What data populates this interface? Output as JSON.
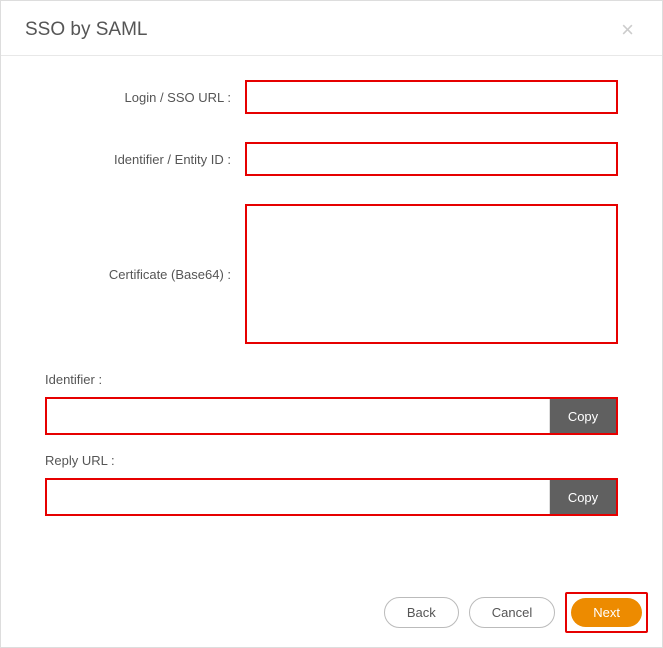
{
  "dialog": {
    "title": "SSO by SAML",
    "close_glyph": "×"
  },
  "fields": {
    "login_url": {
      "label": "Login / SSO URL :",
      "value": ""
    },
    "entity_id": {
      "label": "Identifier / Entity ID :",
      "value": ""
    },
    "certificate": {
      "label": "Certificate (Base64) :",
      "value": ""
    }
  },
  "outputs": {
    "identifier": {
      "label": "Identifier :",
      "value": "",
      "copy_label": "Copy"
    },
    "reply_url": {
      "label": "Reply URL :",
      "value": "",
      "copy_label": "Copy"
    }
  },
  "footer": {
    "back": "Back",
    "cancel": "Cancel",
    "next": "Next"
  }
}
